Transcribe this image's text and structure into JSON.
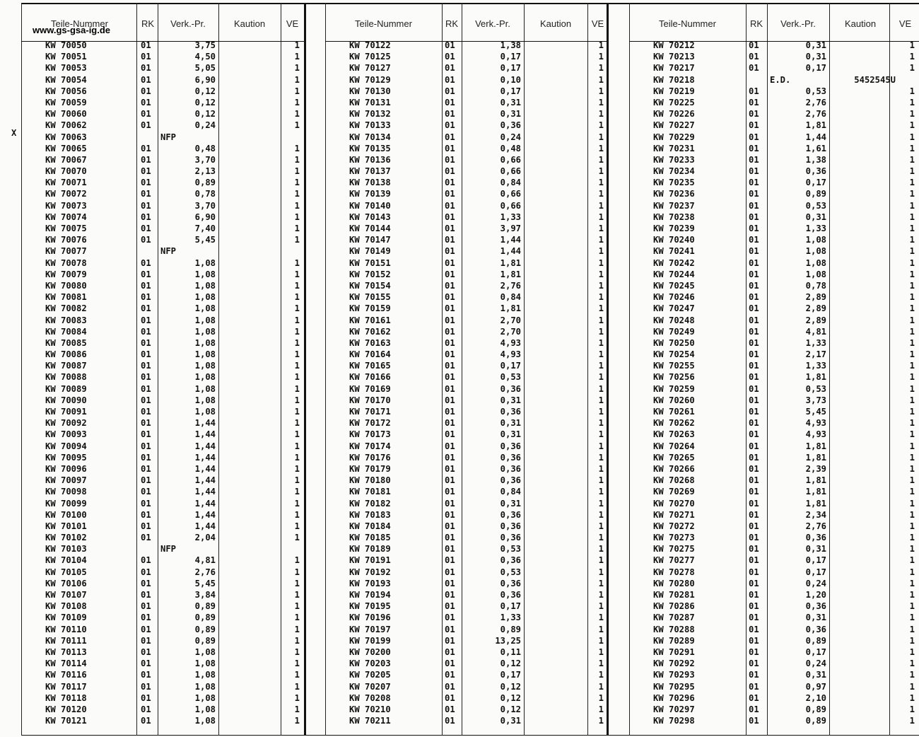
{
  "website": "www.gs-gsa-ig.de",
  "headers": {
    "part": "Teile-Nummer",
    "rk": "RK",
    "price": "Verk.-Pr.",
    "deposit": "Kaution",
    "ve": "VE"
  },
  "marker": "X",
  "columns": [
    [
      [
        "KW 70050",
        "01",
        "3,75",
        "",
        "1"
      ],
      [
        "KW 70051",
        "01",
        "4,50",
        "",
        "1"
      ],
      [
        "KW 70053",
        "01",
        "5,05",
        "",
        "1"
      ],
      [
        "KW 70054",
        "01",
        "6,90",
        "",
        "1"
      ],
      [
        "KW 70056",
        "01",
        "0,12",
        "",
        "1"
      ],
      [
        "KW 70059",
        "01",
        "0,12",
        "",
        "1"
      ],
      [
        "KW 70060",
        "01",
        "0,12",
        "",
        "1"
      ],
      [
        "KW 70062",
        "01",
        "0,24",
        "",
        "1"
      ],
      [
        "KW 70063",
        "",
        "NFP",
        "",
        ""
      ],
      [
        "KW 70065",
        "01",
        "0,48",
        "",
        "1"
      ],
      [
        "KW 70067",
        "01",
        "3,70",
        "",
        "1"
      ],
      [
        "KW 70070",
        "01",
        "2,13",
        "",
        "1"
      ],
      [
        "KW 70071",
        "01",
        "0,89",
        "",
        "1"
      ],
      [
        "KW 70072",
        "01",
        "0,78",
        "",
        "1"
      ],
      [
        "KW 70073",
        "01",
        "3,70",
        "",
        "1"
      ],
      [
        "KW 70074",
        "01",
        "6,90",
        "",
        "1"
      ],
      [
        "KW 70075",
        "01",
        "7,40",
        "",
        "1"
      ],
      [
        "KW 70076",
        "01",
        "5,45",
        "",
        "1"
      ],
      [
        "KW 70077",
        "",
        "NFP",
        "",
        ""
      ],
      [
        "KW 70078",
        "01",
        "1,08",
        "",
        "1"
      ],
      [
        "KW 70079",
        "01",
        "1,08",
        "",
        "1"
      ],
      [
        "KW 70080",
        "01",
        "1,08",
        "",
        "1"
      ],
      [
        "KW 70081",
        "01",
        "1,08",
        "",
        "1"
      ],
      [
        "KW 70082",
        "01",
        "1,08",
        "",
        "1"
      ],
      [
        "KW 70083",
        "01",
        "1,08",
        "",
        "1"
      ],
      [
        "KW 70084",
        "01",
        "1,08",
        "",
        "1"
      ],
      [
        "KW 70085",
        "01",
        "1,08",
        "",
        "1"
      ],
      [
        "KW 70086",
        "01",
        "1,08",
        "",
        "1"
      ],
      [
        "KW 70087",
        "01",
        "1,08",
        "",
        "1"
      ],
      [
        "KW 70088",
        "01",
        "1,08",
        "",
        "1"
      ],
      [
        "KW 70089",
        "01",
        "1,08",
        "",
        "1"
      ],
      [
        "KW 70090",
        "01",
        "1,08",
        "",
        "1"
      ],
      [
        "KW 70091",
        "01",
        "1,08",
        "",
        "1"
      ],
      [
        "KW 70092",
        "01",
        "1,44",
        "",
        "1"
      ],
      [
        "KW 70093",
        "01",
        "1,44",
        "",
        "1"
      ],
      [
        "KW 70094",
        "01",
        "1,44",
        "",
        "1"
      ],
      [
        "KW 70095",
        "01",
        "1,44",
        "",
        "1"
      ],
      [
        "KW 70096",
        "01",
        "1,44",
        "",
        "1"
      ],
      [
        "KW 70097",
        "01",
        "1,44",
        "",
        "1"
      ],
      [
        "KW 70098",
        "01",
        "1,44",
        "",
        "1"
      ],
      [
        "KW 70099",
        "01",
        "1,44",
        "",
        "1"
      ],
      [
        "KW 70100",
        "01",
        "1,44",
        "",
        "1"
      ],
      [
        "KW 70101",
        "01",
        "1,44",
        "",
        "1"
      ],
      [
        "KW 70102",
        "01",
        "2,04",
        "",
        "1"
      ],
      [
        "KW 70103",
        "",
        "NFP",
        "",
        ""
      ],
      [
        "KW 70104",
        "01",
        "4,81",
        "",
        "1"
      ],
      [
        "KW 70105",
        "01",
        "2,76",
        "",
        "1"
      ],
      [
        "KW 70106",
        "01",
        "5,45",
        "",
        "1"
      ],
      [
        "KW 70107",
        "01",
        "3,84",
        "",
        "1"
      ],
      [
        "KW 70108",
        "01",
        "0,89",
        "",
        "1"
      ],
      [
        "KW 70109",
        "01",
        "0,89",
        "",
        "1"
      ],
      [
        "KW 70110",
        "01",
        "0,89",
        "",
        "1"
      ],
      [
        "KW 70111",
        "01",
        "0,89",
        "",
        "1"
      ],
      [
        "KW 70113",
        "01",
        "1,08",
        "",
        "1"
      ],
      [
        "KW 70114",
        "01",
        "1,08",
        "",
        "1"
      ],
      [
        "KW 70116",
        "01",
        "1,08",
        "",
        "1"
      ],
      [
        "KW 70117",
        "01",
        "1,08",
        "",
        "1"
      ],
      [
        "KW 70118",
        "01",
        "1,08",
        "",
        "1"
      ],
      [
        "KW 70120",
        "01",
        "1,08",
        "",
        "1"
      ],
      [
        "KW 70121",
        "01",
        "1,08",
        "",
        "1"
      ]
    ],
    [
      [
        "KW 70122",
        "01",
        "1,38",
        "",
        "1"
      ],
      [
        "KW 70125",
        "01",
        "0,17",
        "",
        "1"
      ],
      [
        "KW 70127",
        "01",
        "0,17",
        "",
        "1"
      ],
      [
        "KW 70129",
        "01",
        "0,10",
        "",
        "1"
      ],
      [
        "KW 70130",
        "01",
        "0,17",
        "",
        "1"
      ],
      [
        "KW 70131",
        "01",
        "0,31",
        "",
        "1"
      ],
      [
        "KW 70132",
        "01",
        "0,31",
        "",
        "1"
      ],
      [
        "KW 70133",
        "01",
        "0,36",
        "",
        "1"
      ],
      [
        "KW 70134",
        "01",
        "0,24",
        "",
        "1"
      ],
      [
        "KW 70135",
        "01",
        "0,48",
        "",
        "1"
      ],
      [
        "KW 70136",
        "01",
        "0,66",
        "",
        "1"
      ],
      [
        "KW 70137",
        "01",
        "0,66",
        "",
        "1"
      ],
      [
        "KW 70138",
        "01",
        "0,84",
        "",
        "1"
      ],
      [
        "KW 70139",
        "01",
        "0,66",
        "",
        "1"
      ],
      [
        "KW 70140",
        "01",
        "0,66",
        "",
        "1"
      ],
      [
        "KW 70143",
        "01",
        "1,33",
        "",
        "1"
      ],
      [
        "KW 70144",
        "01",
        "3,97",
        "",
        "1"
      ],
      [
        "KW 70147",
        "01",
        "1,44",
        "",
        "1"
      ],
      [
        "KW 70149",
        "01",
        "1,44",
        "",
        "1"
      ],
      [
        "KW 70151",
        "01",
        "1,81",
        "",
        "1"
      ],
      [
        "KW 70152",
        "01",
        "1,81",
        "",
        "1"
      ],
      [
        "KW 70154",
        "01",
        "2,76",
        "",
        "1"
      ],
      [
        "KW 70155",
        "01",
        "0,84",
        "",
        "1"
      ],
      [
        "KW 70159",
        "01",
        "1,81",
        "",
        "1"
      ],
      [
        "KW 70161",
        "01",
        "2,70",
        "",
        "1"
      ],
      [
        "KW 70162",
        "01",
        "2,70",
        "",
        "1"
      ],
      [
        "KW 70163",
        "01",
        "4,93",
        "",
        "1"
      ],
      [
        "KW 70164",
        "01",
        "4,93",
        "",
        "1"
      ],
      [
        "KW 70165",
        "01",
        "0,17",
        "",
        "1"
      ],
      [
        "KW 70166",
        "01",
        "0,53",
        "",
        "1"
      ],
      [
        "KW 70169",
        "01",
        "0,36",
        "",
        "1"
      ],
      [
        "KW 70170",
        "01",
        "0,31",
        "",
        "1"
      ],
      [
        "KW 70171",
        "01",
        "0,36",
        "",
        "1"
      ],
      [
        "KW 70172",
        "01",
        "0,31",
        "",
        "1"
      ],
      [
        "KW 70173",
        "01",
        "0,31",
        "",
        "1"
      ],
      [
        "KW 70174",
        "01",
        "0,36",
        "",
        "1"
      ],
      [
        "KW 70176",
        "01",
        "0,36",
        "",
        "1"
      ],
      [
        "KW 70179",
        "01",
        "0,36",
        "",
        "1"
      ],
      [
        "KW 70180",
        "01",
        "0,36",
        "",
        "1"
      ],
      [
        "KW 70181",
        "01",
        "0,84",
        "",
        "1"
      ],
      [
        "KW 70182",
        "01",
        "0,31",
        "",
        "1"
      ],
      [
        "KW 70183",
        "01",
        "0,36",
        "",
        "1"
      ],
      [
        "KW 70184",
        "01",
        "0,36",
        "",
        "1"
      ],
      [
        "KW 70185",
        "01",
        "0,36",
        "",
        "1"
      ],
      [
        "KW 70189",
        "01",
        "0,53",
        "",
        "1"
      ],
      [
        "KW 70191",
        "01",
        "0,36",
        "",
        "1"
      ],
      [
        "KW 70192",
        "01",
        "0,53",
        "",
        "1"
      ],
      [
        "KW 70193",
        "01",
        "0,36",
        "",
        "1"
      ],
      [
        "KW 70194",
        "01",
        "0,36",
        "",
        "1"
      ],
      [
        "KW 70195",
        "01",
        "0,17",
        "",
        "1"
      ],
      [
        "KW 70196",
        "01",
        "1,33",
        "",
        "1"
      ],
      [
        "KW 70197",
        "01",
        "0,89",
        "",
        "1"
      ],
      [
        "KW 70199",
        "01",
        "13,25",
        "",
        "1"
      ],
      [
        "KW 70200",
        "01",
        "0,11",
        "",
        "1"
      ],
      [
        "KW 70203",
        "01",
        "0,12",
        "",
        "1"
      ],
      [
        "KW 70205",
        "01",
        "0,17",
        "",
        "1"
      ],
      [
        "KW 70207",
        "01",
        "0,12",
        "",
        "1"
      ],
      [
        "KW 70208",
        "01",
        "0,12",
        "",
        "1"
      ],
      [
        "KW 70210",
        "01",
        "0,12",
        "",
        "1"
      ],
      [
        "KW 70211",
        "01",
        "0,31",
        "",
        "1"
      ]
    ],
    [
      [
        "KW 70212",
        "01",
        "0,31",
        "",
        "1"
      ],
      [
        "KW 70213",
        "01",
        "0,31",
        "",
        "1"
      ],
      [
        "KW 70217",
        "01",
        "0,17",
        "",
        "1"
      ],
      [
        "KW 70218",
        "",
        "E.D.",
        "5452545U",
        ""
      ],
      [
        "KW 70219",
        "01",
        "0,53",
        "",
        "1"
      ],
      [
        "KW 70225",
        "01",
        "2,76",
        "",
        "1"
      ],
      [
        "KW 70226",
        "01",
        "2,76",
        "",
        "1"
      ],
      [
        "KW 70227",
        "01",
        "1,81",
        "",
        "1"
      ],
      [
        "KW 70229",
        "01",
        "1,44",
        "",
        "1"
      ],
      [
        "KW 70231",
        "01",
        "1,61",
        "",
        "1"
      ],
      [
        "KW 70233",
        "01",
        "1,38",
        "",
        "1"
      ],
      [
        "KW 70234",
        "01",
        "0,36",
        "",
        "1"
      ],
      [
        "KW 70235",
        "01",
        "0,17",
        "",
        "1"
      ],
      [
        "KW 70236",
        "01",
        "0,89",
        "",
        "1"
      ],
      [
        "KW 70237",
        "01",
        "0,53",
        "",
        "1"
      ],
      [
        "KW 70238",
        "01",
        "0,31",
        "",
        "1"
      ],
      [
        "KW 70239",
        "01",
        "1,33",
        "",
        "1"
      ],
      [
        "KW 70240",
        "01",
        "1,08",
        "",
        "1"
      ],
      [
        "KW 70241",
        "01",
        "1,08",
        "",
        "1"
      ],
      [
        "KW 70242",
        "01",
        "1,08",
        "",
        "1"
      ],
      [
        "KW 70244",
        "01",
        "1,08",
        "",
        "1"
      ],
      [
        "KW 70245",
        "01",
        "0,78",
        "",
        "1"
      ],
      [
        "KW 70246",
        "01",
        "2,89",
        "",
        "1"
      ],
      [
        "KW 70247",
        "01",
        "2,89",
        "",
        "1"
      ],
      [
        "KW 70248",
        "01",
        "2,89",
        "",
        "1"
      ],
      [
        "KW 70249",
        "01",
        "4,81",
        "",
        "1"
      ],
      [
        "KW 70250",
        "01",
        "1,33",
        "",
        "1"
      ],
      [
        "KW 70254",
        "01",
        "2,17",
        "",
        "1"
      ],
      [
        "KW 70255",
        "01",
        "1,33",
        "",
        "1"
      ],
      [
        "KW 70256",
        "01",
        "1,81",
        "",
        "1"
      ],
      [
        "KW 70259",
        "01",
        "0,53",
        "",
        "1"
      ],
      [
        "KW 70260",
        "01",
        "3,73",
        "",
        "1"
      ],
      [
        "KW 70261",
        "01",
        "5,45",
        "",
        "1"
      ],
      [
        "KW 70262",
        "01",
        "4,93",
        "",
        "1"
      ],
      [
        "KW 70263",
        "01",
        "4,93",
        "",
        "1"
      ],
      [
        "KW 70264",
        "01",
        "1,81",
        "",
        "1"
      ],
      [
        "KW 70265",
        "01",
        "1,81",
        "",
        "1"
      ],
      [
        "KW 70266",
        "01",
        "2,39",
        "",
        "1"
      ],
      [
        "KW 70268",
        "01",
        "1,81",
        "",
        "1"
      ],
      [
        "KW 70269",
        "01",
        "1,81",
        "",
        "1"
      ],
      [
        "KW 70270",
        "01",
        "1,81",
        "",
        "1"
      ],
      [
        "KW 70271",
        "01",
        "2,34",
        "",
        "1"
      ],
      [
        "KW 70272",
        "01",
        "2,76",
        "",
        "1"
      ],
      [
        "KW 70273",
        "01",
        "0,36",
        "",
        "1"
      ],
      [
        "KW 70275",
        "01",
        "0,31",
        "",
        "1"
      ],
      [
        "KW 70277",
        "01",
        "0,17",
        "",
        "1"
      ],
      [
        "KW 70278",
        "01",
        "0,17",
        "",
        "1"
      ],
      [
        "KW 70280",
        "01",
        "0,24",
        "",
        "1"
      ],
      [
        "KW 70281",
        "01",
        "1,20",
        "",
        "1"
      ],
      [
        "KW 70286",
        "01",
        "0,36",
        "",
        "1"
      ],
      [
        "KW 70287",
        "01",
        "0,31",
        "",
        "1"
      ],
      [
        "KW 70288",
        "01",
        "0,36",
        "",
        "1"
      ],
      [
        "KW 70289",
        "01",
        "0,89",
        "",
        "1"
      ],
      [
        "KW 70291",
        "01",
        "0,17",
        "",
        "1"
      ],
      [
        "KW 70292",
        "01",
        "0,24",
        "",
        "1"
      ],
      [
        "KW 70293",
        "01",
        "0,31",
        "",
        "1"
      ],
      [
        "KW 70295",
        "01",
        "0,97",
        "",
        "1"
      ],
      [
        "KW 70296",
        "01",
        "2,10",
        "",
        "1"
      ],
      [
        "KW 70297",
        "01",
        "0,89",
        "",
        "1"
      ],
      [
        "KW 70298",
        "01",
        "0,89",
        "",
        "1"
      ]
    ]
  ]
}
